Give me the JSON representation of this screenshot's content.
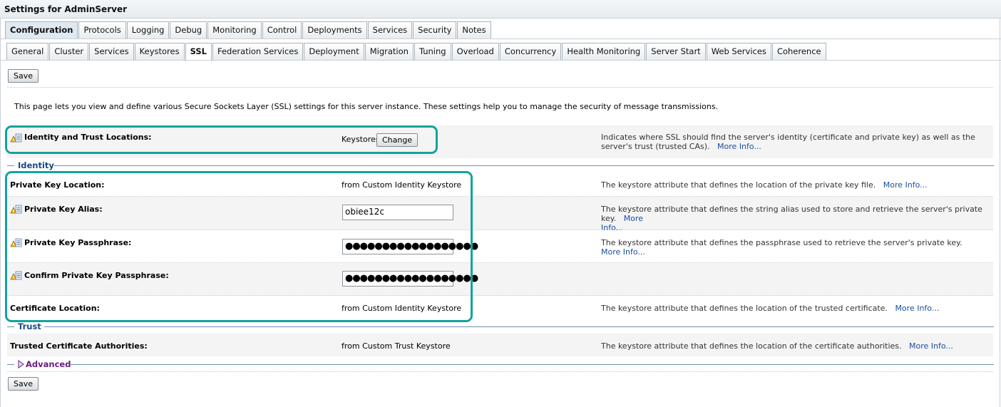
{
  "page": {
    "title": "Settings for AdminServer"
  },
  "tabs_primary": [
    "Configuration",
    "Protocols",
    "Logging",
    "Debug",
    "Monitoring",
    "Control",
    "Deployments",
    "Services",
    "Security",
    "Notes"
  ],
  "tabs_secondary": [
    "General",
    "Cluster",
    "Services",
    "Keystores",
    "SSL",
    "Federation Services",
    "Deployment",
    "Migration",
    "Tuning",
    "Overload",
    "Concurrency",
    "Health Monitoring",
    "Server Start",
    "Web Services",
    "Coherence"
  ],
  "active_primary": "Configuration",
  "active_secondary": "SSL",
  "buttons": {
    "save": "Save",
    "change": "Change"
  },
  "intro": "This page lets you view and define various Secure Sockets Layer (SSL) settings for this server instance. These settings help you to manage the security of message transmissions.",
  "identity_trust": {
    "label": "Identity and Trust Locations:",
    "value": "Keystores",
    "desc": "Indicates where SSL should find the server's identity (certificate and private key) as well as the server's trust (trusted CAs).",
    "more": "More Info..."
  },
  "sections": {
    "identity": "Identity",
    "trust": "Trust",
    "advanced": "Advanced"
  },
  "identity_rows": {
    "private_key_location": {
      "label": "Private Key Location:",
      "value": "from Custom Identity Keystore",
      "desc": "The keystore attribute that defines the location of the private key file.",
      "more": "More Info..."
    },
    "private_key_alias": {
      "label": "Private Key Alias:",
      "value": "obiee12c",
      "desc": "The keystore attribute that defines the string alias used to store and retrieve the server's private key.",
      "more_a": "More",
      "more_b": "Info..."
    },
    "private_key_passphrase": {
      "label": "Private Key Passphrase:",
      "value": "●●●●●●●●●●●●●●●●●●",
      "desc": "The keystore attribute that defines the passphrase used to retrieve the server's private key.",
      "more": "More Info..."
    },
    "confirm_passphrase": {
      "label": "Confirm Private Key Passphrase:",
      "value": "●●●●●●●●●●●●●●●●●●"
    },
    "certificate_location": {
      "label": "Certificate Location:",
      "value": "from Custom Identity Keystore",
      "desc": "The keystore attribute that defines the location of the trusted certificate.",
      "more": "More Info..."
    }
  },
  "trust_rows": {
    "trusted_cas": {
      "label": "Trusted Certificate Authorities:",
      "value": "from Custom Trust Keystore",
      "desc": "The keystore attribute that defines the location of the certificate authorities.",
      "more": "More Info..."
    }
  },
  "colors": {
    "highlight": "#13a39b",
    "link": "#1b4fa0",
    "section": "#1a4a86",
    "advanced": "#6a1c82"
  }
}
